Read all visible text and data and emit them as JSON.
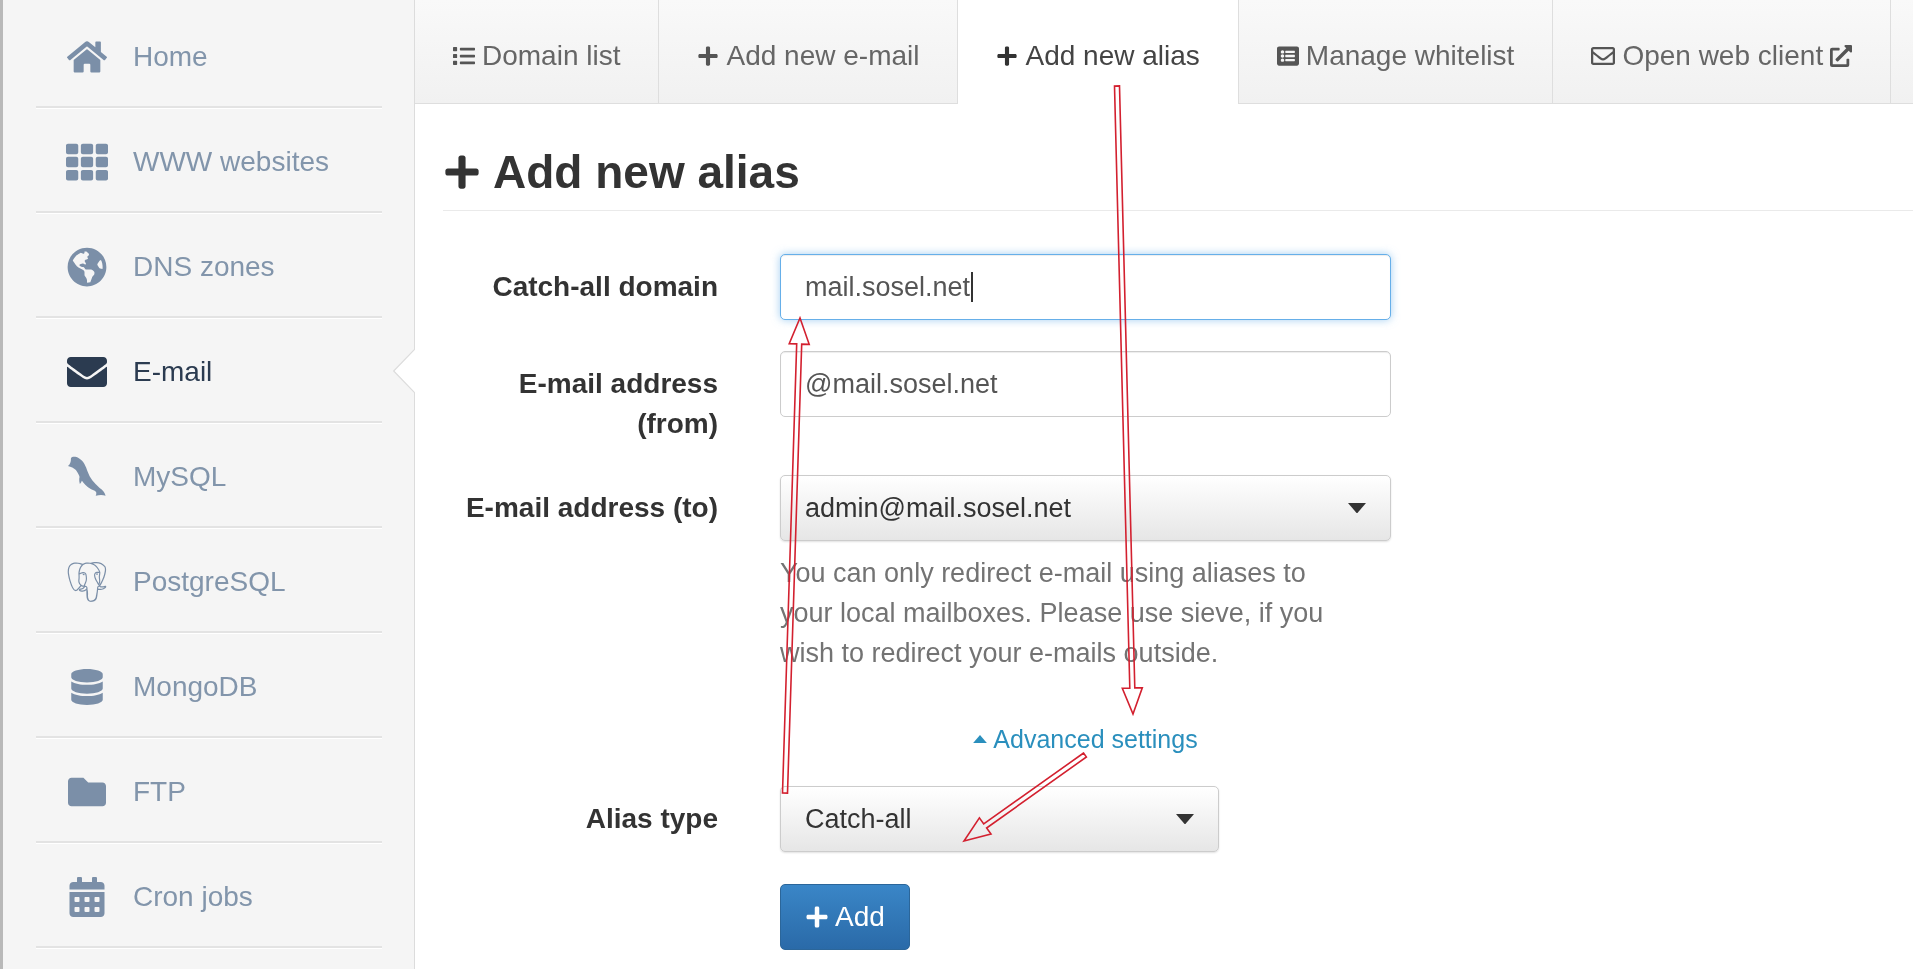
{
  "sidebar": {
    "items": [
      {
        "label": "Home",
        "selected": false
      },
      {
        "label": "WWW websites",
        "selected": false
      },
      {
        "label": "DNS zones",
        "selected": false
      },
      {
        "label": "E-mail",
        "selected": true
      },
      {
        "label": "MySQL",
        "selected": false
      },
      {
        "label": "PostgreSQL",
        "selected": false
      },
      {
        "label": "MongoDB",
        "selected": false
      },
      {
        "label": "FTP",
        "selected": false
      },
      {
        "label": "Cron jobs",
        "selected": false
      }
    ]
  },
  "tabs": [
    {
      "label": "Domain list",
      "selected": false
    },
    {
      "label": "Add new e-mail",
      "selected": false
    },
    {
      "label": "Add new alias",
      "selected": true
    },
    {
      "label": "Manage whitelist",
      "selected": false
    },
    {
      "label": "Open web client",
      "selected": false
    }
  ],
  "page_title": "Add new alias",
  "form": {
    "fields": [
      {
        "kind": "input",
        "label": "Catch-all domain",
        "value": "mail.sosel.net",
        "focused": true
      },
      {
        "kind": "input",
        "label": "E-mail address (from)",
        "value": "@mail.sosel.net",
        "focused": false
      },
      {
        "kind": "select",
        "label": "E-mail address (to)",
        "value": "admin@mail.sosel.net",
        "focused": false,
        "help": "You can only redirect e-mail using aliases to your local mailboxes. Please use sieve, if you wish to redirect your e-mails outside."
      }
    ],
    "advanced_toggle": {
      "label": "Advanced settings",
      "expanded": true
    },
    "advanced_fields": [
      {
        "kind": "select",
        "label": "Alias type",
        "value": "Catch-all",
        "focused": false
      }
    ],
    "submit_button": {
      "label": "Add"
    }
  }
}
